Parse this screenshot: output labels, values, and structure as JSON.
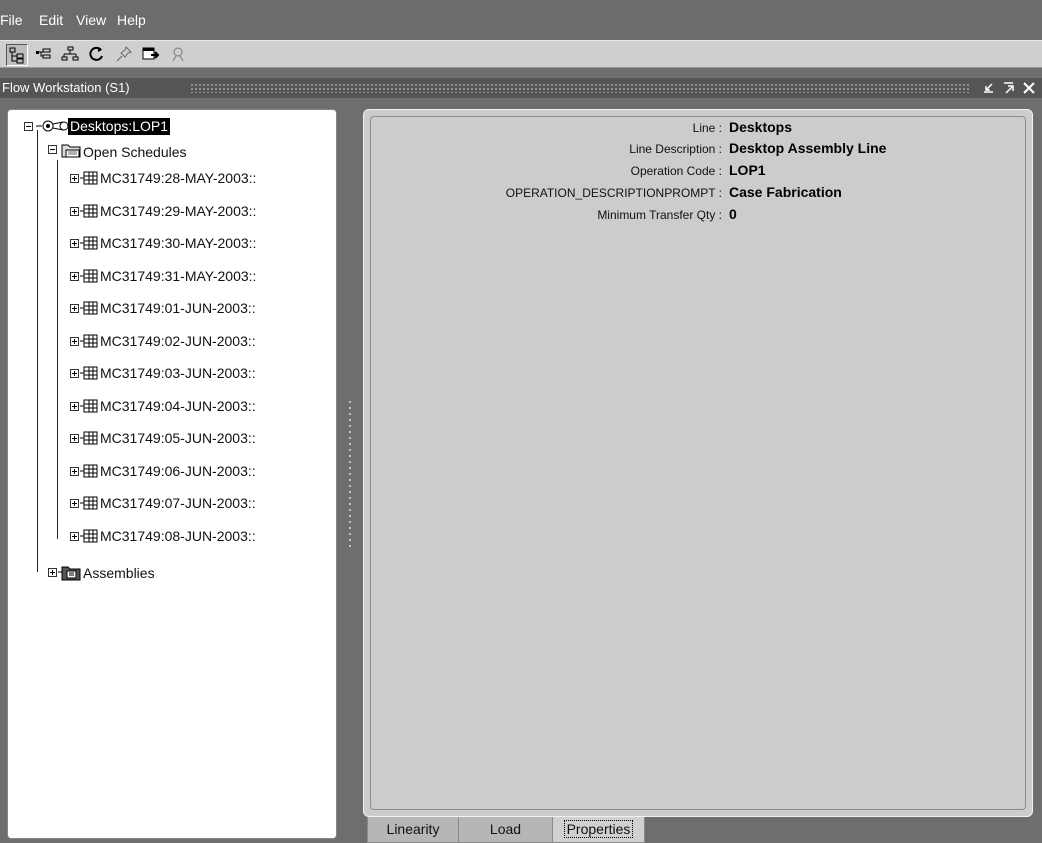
{
  "menu": {
    "items": [
      {
        "label": "File"
      },
      {
        "label": "Edit"
      },
      {
        "label": "View"
      },
      {
        "label": "Help"
      }
    ]
  },
  "toolbar": {
    "buttons": [
      {
        "icon": "tree-view-icon",
        "active": true
      },
      {
        "icon": "expand-branch-icon"
      },
      {
        "icon": "hierarchy-icon"
      },
      {
        "icon": "refresh-icon"
      },
      {
        "icon": "pin-icon"
      },
      {
        "icon": "dispatch-icon"
      },
      {
        "icon": "search-person-icon"
      }
    ]
  },
  "window": {
    "title": "Flow Workstation  (S1)",
    "controls": [
      "minimize-icon",
      "maximize-icon",
      "close-icon"
    ]
  },
  "tree": {
    "root": {
      "label": "Desktops:LOP1",
      "icon": "line-node-icon"
    },
    "open_schedules": {
      "label": "Open Schedules",
      "icon": "folder-open-icon"
    },
    "schedules": [
      "MC31749:28-MAY-2003::",
      "MC31749:29-MAY-2003::",
      "MC31749:30-MAY-2003::",
      "MC31749:31-MAY-2003::",
      "MC31749:01-JUN-2003::",
      "MC31749:02-JUN-2003::",
      "MC31749:03-JUN-2003::",
      "MC31749:04-JUN-2003::",
      "MC31749:05-JUN-2003::",
      "MC31749:06-JUN-2003::",
      "MC31749:07-JUN-2003::",
      "MC31749:08-JUN-2003::"
    ],
    "assemblies": {
      "label": "Assemblies",
      "icon": "assemblies-folder-icon"
    }
  },
  "properties": [
    {
      "label": "Line :",
      "value": "Desktops"
    },
    {
      "label": "Line Description :",
      "value": "Desktop Assembly Line"
    },
    {
      "label": "Operation Code :",
      "value": "LOP1"
    },
    {
      "label": "OPERATION_DESCRIPTIONPROMPT :",
      "value": "Case Fabrication"
    },
    {
      "label": "Minimum Transfer Qty :",
      "value": "0"
    }
  ],
  "tabs": [
    {
      "label": "Linearity"
    },
    {
      "label": "Load"
    },
    {
      "label": "Properties",
      "active": true
    }
  ]
}
